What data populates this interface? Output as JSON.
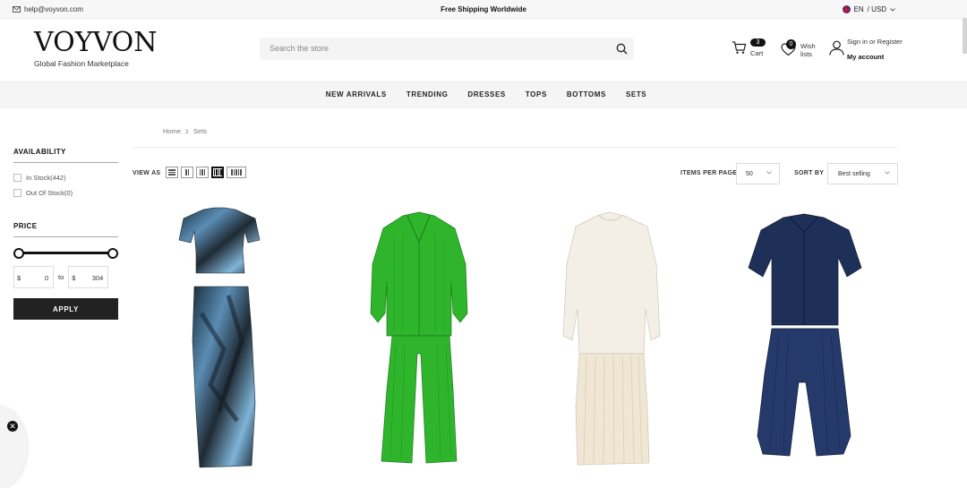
{
  "topbar": {
    "email": "help@voyvon.com",
    "shipping": "Free Shipping Worldwide",
    "language": "EN",
    "currency": "/ USD"
  },
  "brand": {
    "name": "VOYVON",
    "tagline": "Global Fashion Marketplace"
  },
  "search": {
    "placeholder": "Search the store"
  },
  "header": {
    "cart_count": "3",
    "cart_label": "Cart",
    "wishlist_count": "0",
    "wishlist_label": "Wish lists",
    "signin_label": "Sign in",
    "or_register": "or Register",
    "account_label": "My account"
  },
  "nav": [
    "NEW ARRIVALS",
    "TRENDING",
    "DRESSES",
    "TOPS",
    "BOTTOMS",
    "SETS"
  ],
  "breadcrumb": {
    "home": "Home",
    "current": "Sets"
  },
  "filters": {
    "availability_title": "AVAILABILITY",
    "in_stock": "In Stock(442)",
    "out_of_stock": "Out Of Stock(0)",
    "price_title": "PRICE",
    "currency_symbol": "$",
    "price_min": "0",
    "price_max": "304",
    "to_label": "to",
    "apply_label": "APPLY"
  },
  "toolbar": {
    "view_as": "VIEW AS",
    "items_per_page_label": "ITEMS PER PAGE",
    "items_per_page": "50",
    "sort_by_label": "SORT BY",
    "sort_by": "Best selling"
  },
  "colors": {
    "accent": "#222222",
    "green": "#2fb52c",
    "navy": "#1f3058",
    "cream": "#f0ebe0",
    "print_blue": "#3b7fae"
  },
  "products": [
    {
      "icon": "printed-skirt-set-image"
    },
    {
      "icon": "green-pleated-set-image"
    },
    {
      "icon": "cream-sweater-skirt-set-image"
    },
    {
      "icon": "navy-shirt-shorts-set-image"
    }
  ]
}
